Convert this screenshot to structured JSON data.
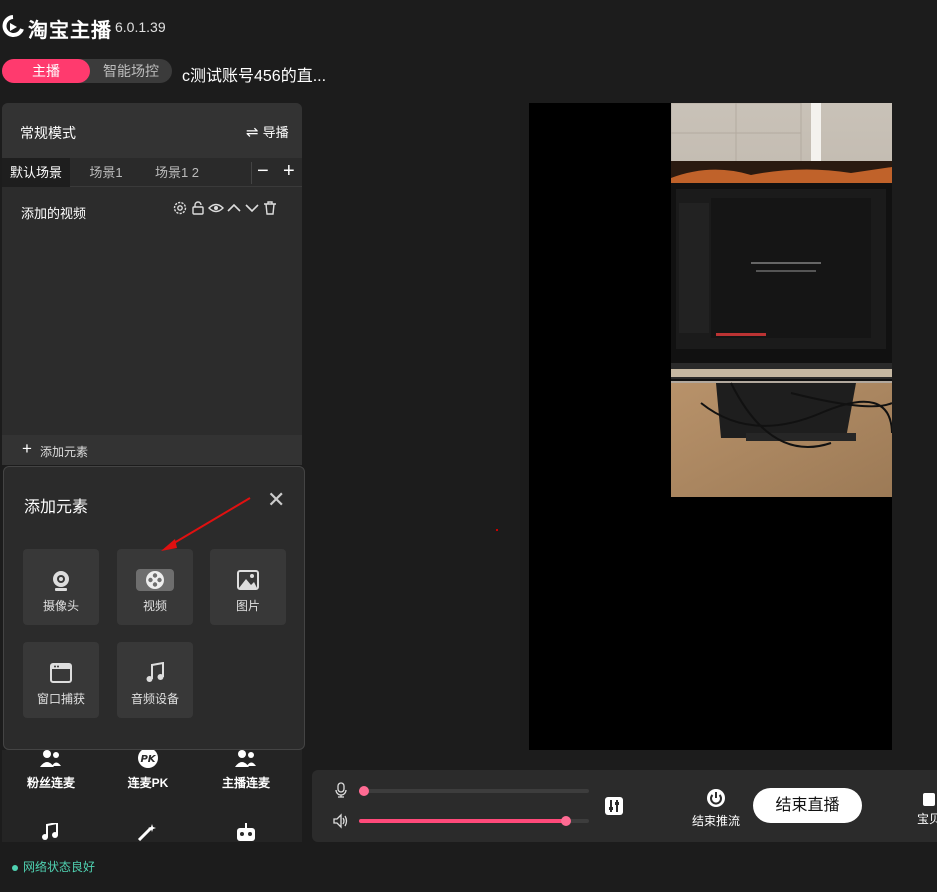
{
  "app": {
    "name": "淘宝主播",
    "version": "6.0.1.39"
  },
  "mode_switch": {
    "host": "主播",
    "smart": "智能场控"
  },
  "room_title": "c测试账号456的直...",
  "panel": {
    "mode_label": "常规模式",
    "director_label": "导播",
    "scenes": [
      "默认场景",
      "场景1",
      "场景1 2"
    ],
    "scene_minus": "−",
    "scene_plus": "+",
    "source_name": "添加的视频",
    "add_element": "添加元素"
  },
  "popup": {
    "title": "添加元素",
    "items": [
      "摄像头",
      "视频",
      "图片",
      "窗口捕获",
      "音频设备"
    ]
  },
  "tools": [
    "粉丝连麦",
    "连麦PK",
    "主播连麦"
  ],
  "status": {
    "network": "网络状态良好"
  },
  "controls": {
    "mic_level": 0.02,
    "speaker_level": 0.9,
    "stop_push_label": "结束推流",
    "end_live_label": "结束直播",
    "baby_label": "宝贝"
  },
  "colors": {
    "accent": "#ff3a6e",
    "status": "#4fd1b1"
  }
}
